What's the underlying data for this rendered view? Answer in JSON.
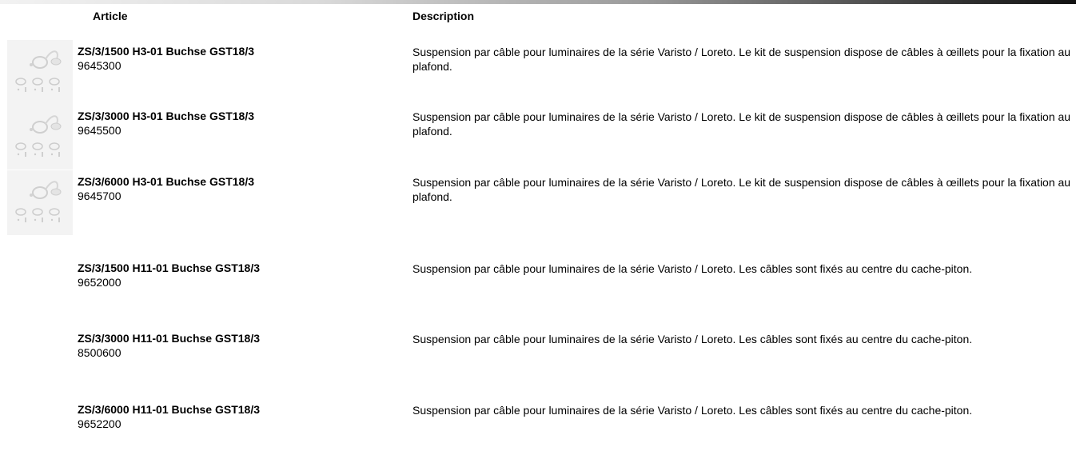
{
  "headers": {
    "article": "Article",
    "description": "Description"
  },
  "rows": [
    {
      "name": "ZS/3/1500 H3-01 Buchse GST18/3",
      "number": "9645300",
      "description": "Suspension par câble pour luminaires de la série Varisto / Loreto. Le kit de suspension dispose de câbles à œillets pour la fixation au plafond.",
      "has_image": true
    },
    {
      "name": "ZS/3/3000 H3-01 Buchse GST18/3",
      "number": "9645500",
      "description": "Suspension par câble pour luminaires de la série Varisto / Loreto. Le kit de suspension dispose de câbles à œillets pour la fixation au plafond.",
      "has_image": true
    },
    {
      "name": "ZS/3/6000 H3-01 Buchse GST18/3",
      "number": "9645700",
      "description": "Suspension par câble pour luminaires de la série Varisto / Loreto. Le kit de suspension dispose de câbles à œillets pour la fixation au plafond.",
      "has_image": true
    },
    {
      "name": "ZS/3/1500 H11-01 Buchse GST18/3",
      "number": "9652000",
      "description": "Suspension par câble pour luminaires de la série Varisto / Loreto. Les câbles sont fixés au centre du cache-piton.",
      "has_image": false
    },
    {
      "name": "ZS/3/3000 H11-01 Buchse GST18/3",
      "number": "8500600",
      "description": "Suspension par câble pour luminaires de la série Varisto / Loreto. Les câbles sont fixés au centre du cache-piton.",
      "has_image": false
    },
    {
      "name": "ZS/3/6000 H11-01 Buchse GST18/3",
      "number": "9652200",
      "description": "Suspension par câble pour luminaires de la série Varisto / Loreto. Les câbles sont fixés au centre du cache-piton.",
      "has_image": false
    }
  ]
}
